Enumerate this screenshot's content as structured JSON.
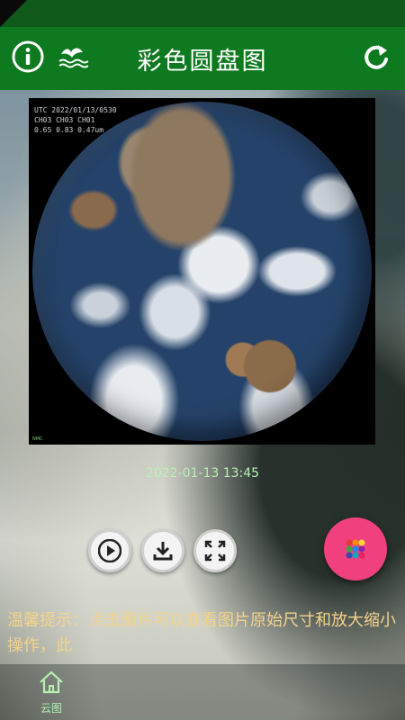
{
  "header": {
    "title": "彩色圆盘图",
    "icons": [
      "info-icon",
      "logo-icon",
      "refresh-icon"
    ]
  },
  "image": {
    "overlay_text": "UTC 2022/01/13/0530\nCH03 CH03 CH01\n0.65 0.83 0.47um",
    "corner_text": "NMC"
  },
  "timestamp": "2022-01-13 13:45",
  "controls": {
    "icons": [
      "play-icon",
      "download-icon",
      "expand-icon",
      "dots-icon"
    ]
  },
  "tip_text": "温馨提示：点击图片可以查看图片原始尺寸和放大缩小操作，此",
  "bottom_nav": {
    "items": [
      {
        "label": "云图",
        "icon": "home-icon"
      }
    ]
  },
  "colors": {
    "app_bar": "#0e7a1f",
    "accent_fab": "#f0417e",
    "tip_text": "#f3d38a",
    "timestamp_text": "#b7f0b2"
  }
}
